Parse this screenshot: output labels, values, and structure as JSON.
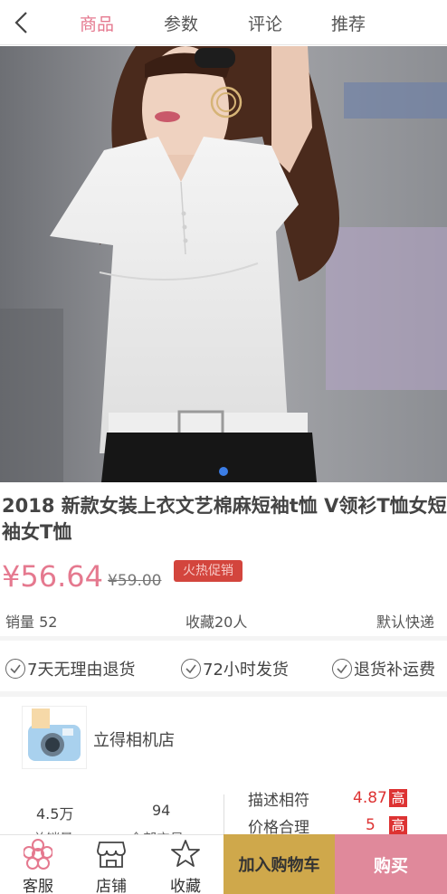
{
  "nav": {
    "back_icon": "chevron-left-icon",
    "tabs": [
      {
        "label": "商品",
        "active": true
      },
      {
        "label": "参数",
        "active": false
      },
      {
        "label": "评论",
        "active": false
      },
      {
        "label": "推荐",
        "active": false
      }
    ]
  },
  "gallery": {
    "current_index": 1,
    "total": 1
  },
  "product": {
    "title": "2018 新款女装上衣文艺棉麻短袖t恤 V领衫T恤女短袖女T恤",
    "price": "¥56.64",
    "original_price": "¥59.00",
    "badge": "火热促销"
  },
  "stats": {
    "sales": "销量 52",
    "favorites": "收藏20人",
    "shipping": "默认快递"
  },
  "services": [
    "7天无理由退货",
    "72小时发货",
    "退货补运费"
  ],
  "shop": {
    "name": "立得相机店",
    "total_sales": "4.5万",
    "total_sales_label": "总销量",
    "all_products": "94",
    "all_products_label": "全部宝贝",
    "ratings": [
      {
        "label": "描述相符",
        "score": "4.87",
        "level": "高"
      },
      {
        "label": "价格合理",
        "score": "5",
        "level": "高"
      }
    ]
  },
  "footer": {
    "service": "客服",
    "store": "店铺",
    "favorite": "收藏",
    "add_to_cart": "加入购物车",
    "buy_now": "购买"
  },
  "colors": {
    "accent_pink": "#e5798f",
    "cart_gold": "#cfa84b",
    "buy_pink": "#e0899b",
    "badge_red": "#d3453d",
    "dot_blue": "#3b7de6"
  }
}
